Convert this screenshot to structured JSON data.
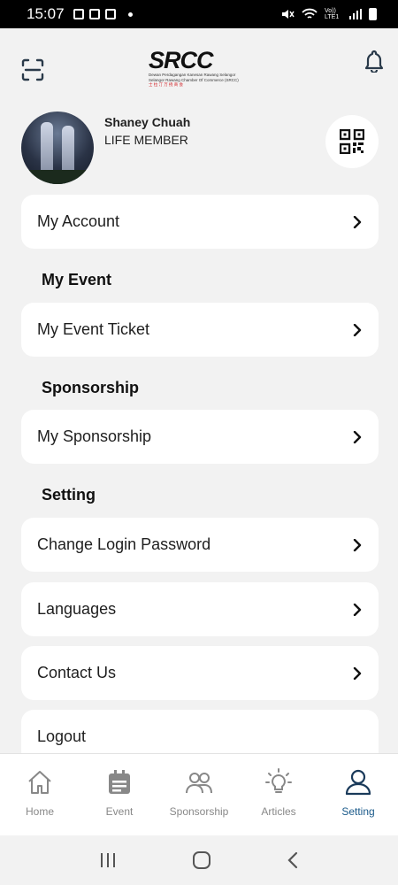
{
  "status_bar": {
    "time": "15:07",
    "network": "Vo)) LTE1"
  },
  "header": {
    "logo": {
      "name": "SRCC",
      "line1": "Dewan Perdagangan Kanesan Rawang Selangor",
      "line2": "Selangor Rawang Chamber Of Commerce (SRCC)",
      "line3": "士 拉 汀 万 挠 商 会"
    }
  },
  "profile": {
    "name": "Shaney Chuah",
    "tier": "LIFE MEMBER"
  },
  "menu": {
    "my_account": "My Account",
    "sections": {
      "event": "My Event",
      "sponsorship": "Sponsorship",
      "setting": "Setting"
    },
    "my_event_ticket": "My Event Ticket",
    "my_sponsorship": "My Sponsorship",
    "change_password": "Change Login Password",
    "languages": "Languages",
    "contact_us": "Contact Us",
    "logout": "Logout"
  },
  "bottom_nav": {
    "items": [
      {
        "label": "Home",
        "icon": "home-icon",
        "active": false
      },
      {
        "label": "Event",
        "icon": "calendar-icon",
        "active": false
      },
      {
        "label": "Sponsorship",
        "icon": "people-icon",
        "active": false
      },
      {
        "label": "Articles",
        "icon": "lightbulb-icon",
        "active": false
      },
      {
        "label": "Setting",
        "icon": "user-icon",
        "active": true
      }
    ]
  },
  "colors": {
    "active_nav": "#1a5a8a",
    "inactive_nav": "#888888",
    "background": "#f2f2f2",
    "card": "#ffffff",
    "logo_red": "#d0191e"
  }
}
